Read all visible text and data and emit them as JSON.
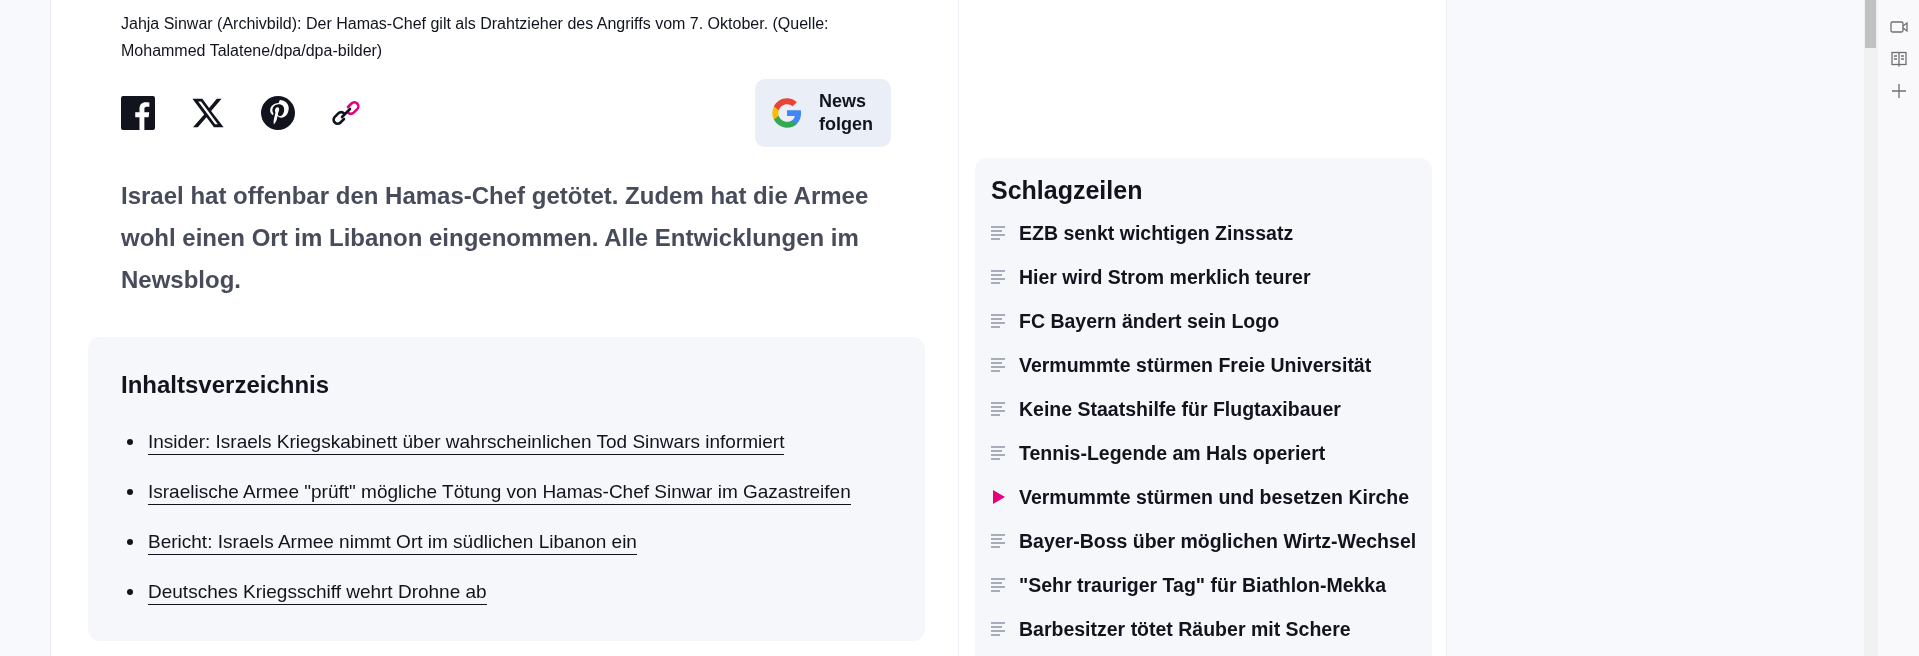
{
  "article": {
    "caption": "Jahja Sinwar (Archivbild): Der Hamas-Chef gilt als Drahtzieher des Angriffs vom 7. Oktober. (Quelle: Mohammed Talatene/dpa/dpa-bilder)",
    "share": [
      {
        "kind": "facebook"
      },
      {
        "kind": "x"
      },
      {
        "kind": "pinterest"
      },
      {
        "kind": "link"
      }
    ],
    "news_button": {
      "label_1": "News",
      "label_2": "folgen"
    },
    "lead": "Israel hat offenbar den Hamas-Chef getötet. Zudem hat die Armee wohl einen Ort im Libanon eingenommen. Alle Entwicklungen im Newsblog.",
    "toc": {
      "title": "Inhaltsverzeichnis",
      "items": [
        {
          "label": "Insider: Israels Kriegskabinett über wahrscheinlichen Tod Sinwars informiert"
        },
        {
          "label": "Israelische Armee \"prüft\" mögliche Tötung von Hamas-Chef Sinwar im Gazastreifen"
        },
        {
          "label": "Bericht: Israels Armee nimmt Ort im südlichen Libanon ein"
        },
        {
          "label": "Deutsches Kriegsschiff wehrt Drohne ab"
        }
      ]
    }
  },
  "headlines": {
    "title": "Schlagzeilen",
    "items": [
      {
        "kind": "text",
        "label": "EZB senkt wichtigen Zinssatz"
      },
      {
        "kind": "text",
        "label": "Hier wird Strom merklich teurer"
      },
      {
        "kind": "text",
        "label": "FC Bayern ändert sein Logo"
      },
      {
        "kind": "text",
        "label": "Vermummte stürmen Freie Universität"
      },
      {
        "kind": "text",
        "label": "Keine Staatshilfe für Flugtaxibauer"
      },
      {
        "kind": "text",
        "label": "Tennis-Legende am Hals operiert"
      },
      {
        "kind": "video",
        "label": "Vermummte stürmen und besetzen Kirche"
      },
      {
        "kind": "text",
        "label": "Bayer-Boss über möglichen Wirtz-Wechsel"
      },
      {
        "kind": "text",
        "label": "\"Sehr trauriger Tag\" für Biathlon-Mekka"
      },
      {
        "kind": "text",
        "label": "Barbesitzer tötet Räuber mit Schere"
      }
    ]
  },
  "browser_sidebar": [
    {
      "kind": "video"
    },
    {
      "kind": "reader"
    },
    {
      "kind": "add"
    }
  ]
}
